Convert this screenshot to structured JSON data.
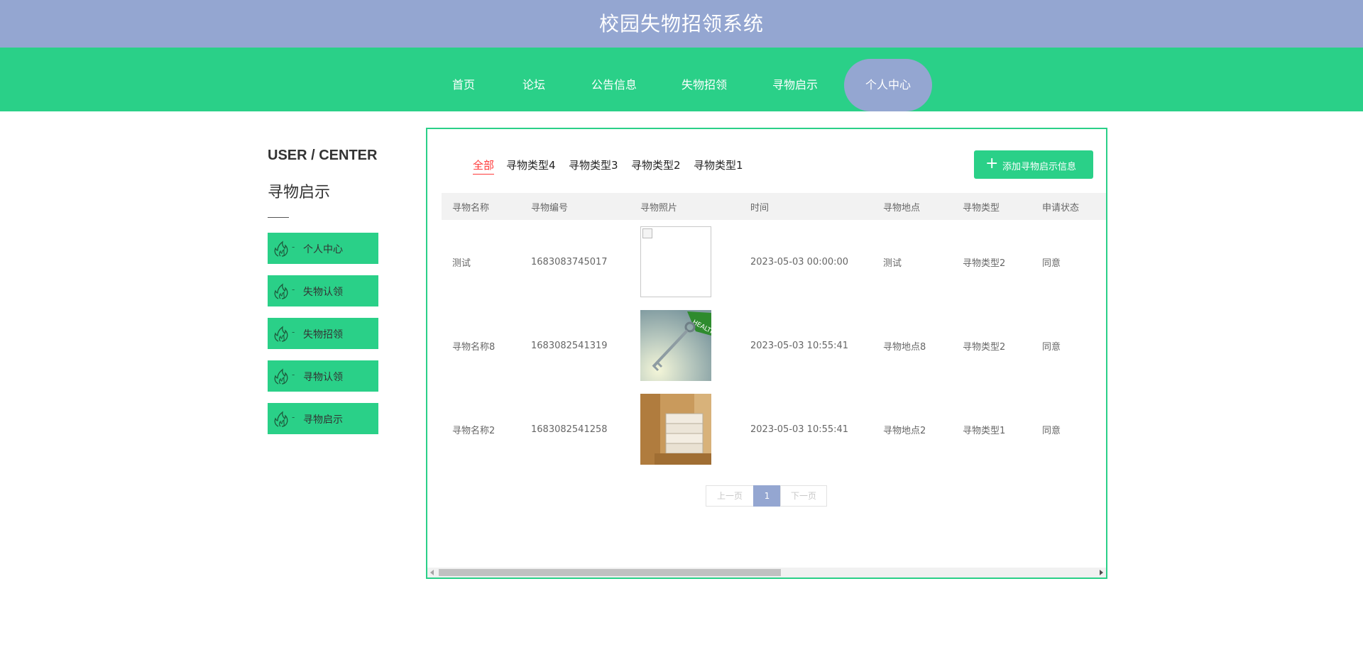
{
  "app": {
    "title": "校园失物招领系统"
  },
  "nav": {
    "items": [
      {
        "label": "首页"
      },
      {
        "label": "论坛"
      },
      {
        "label": "公告信息"
      },
      {
        "label": "失物招领"
      },
      {
        "label": "寻物启示"
      },
      {
        "label": "个人中心"
      }
    ],
    "active": "个人中心"
  },
  "sidebar": {
    "heading_en": "USER / CENTER",
    "heading_cn": "寻物启示",
    "items": [
      {
        "label": "个人中心",
        "icon": "flame-icon"
      },
      {
        "label": "失物认领",
        "icon": "flame-icon"
      },
      {
        "label": "失物招领",
        "icon": "flame-icon"
      },
      {
        "label": "寻物认领",
        "icon": "flame-icon"
      },
      {
        "label": "寻物启示",
        "icon": "flame-icon"
      }
    ]
  },
  "filter": {
    "tabs": [
      "全部",
      "寻物类型4",
      "寻物类型3",
      "寻物类型2",
      "寻物类型1"
    ],
    "active": "全部"
  },
  "actions": {
    "add_label": "添加寻物启示信息",
    "add_icon": "plus-icon"
  },
  "table": {
    "headers": [
      "寻物名称",
      "寻物编号",
      "寻物照片",
      "时间",
      "寻物地点",
      "寻物类型",
      "申请状态"
    ],
    "rows": [
      {
        "name": "测试",
        "code": "1683083745017",
        "photo": "broken-image",
        "time": "2023-05-03 00:00:00",
        "place": "测试",
        "type": "寻物类型2",
        "status": "同意"
      },
      {
        "name": "寻物名称8",
        "code": "1683082541319",
        "photo": "key-photo",
        "time": "2023-05-03 10:55:41",
        "place": "寻物地点8",
        "type": "寻物类型2",
        "status": "同意"
      },
      {
        "name": "寻物名称2",
        "code": "1683082541258",
        "photo": "books-photo",
        "time": "2023-05-03 10:55:41",
        "place": "寻物地点2",
        "type": "寻物类型1",
        "status": "同意"
      }
    ]
  },
  "pagination": {
    "prev": "上一页",
    "current": "1",
    "next": "下一页"
  },
  "colors": {
    "header": "#94a6d1",
    "accent": "#2ad088",
    "active_tab": "#ff3a3a"
  }
}
